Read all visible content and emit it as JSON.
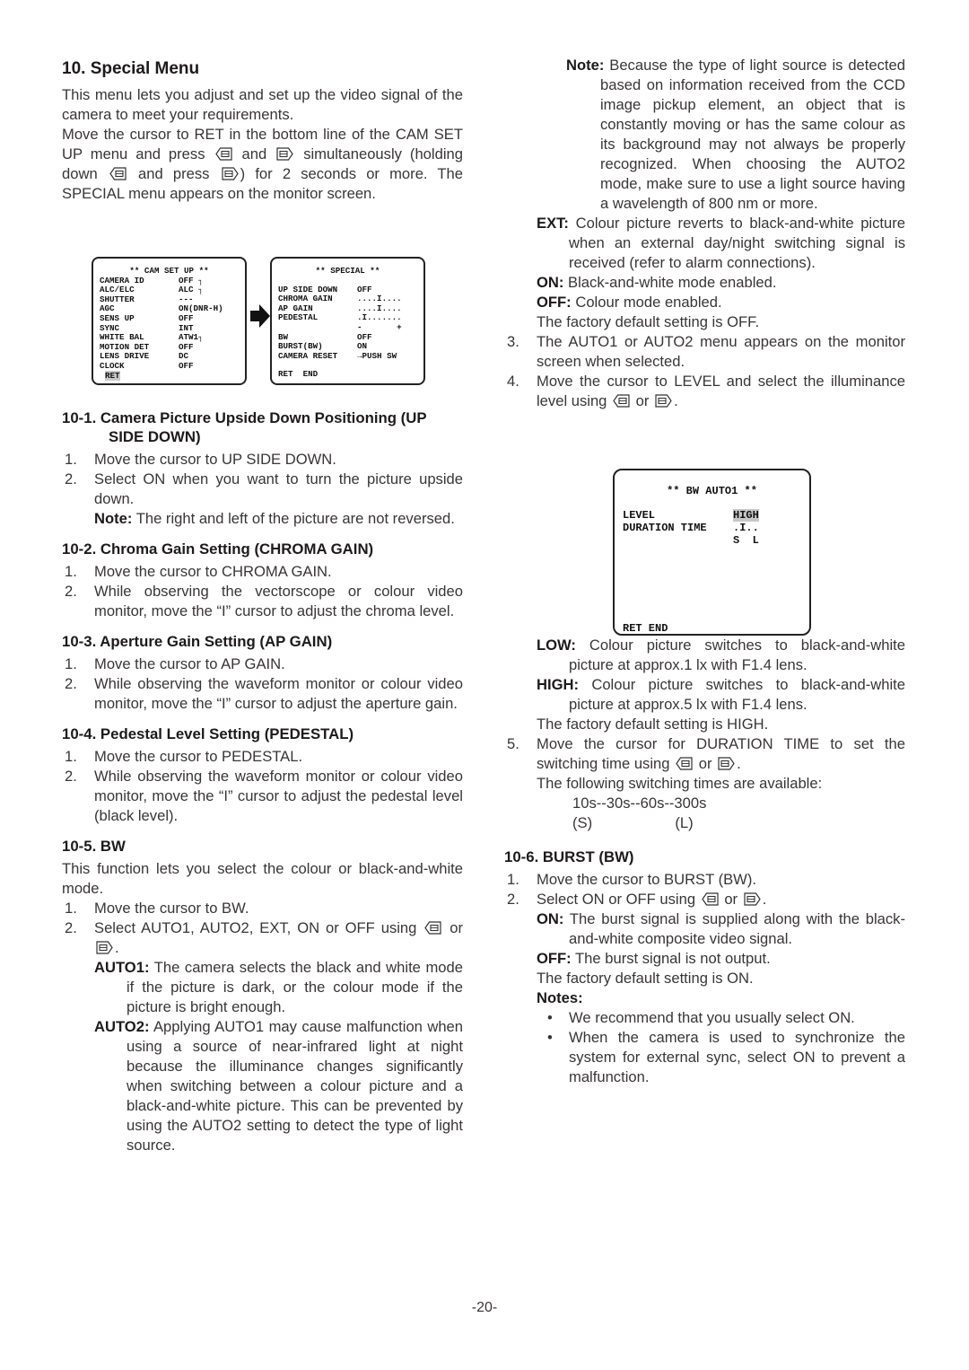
{
  "section": {
    "title": "10. Special Menu",
    "intro": "This menu lets you adjust and set up the video signal of the camera to meet your requirements.",
    "instr_1": "Move the cursor to RET in the bottom line of the CAM SET UP menu and press",
    "instr_2": "and",
    "instr_3": "simultaneously (holding down",
    "instr_4": "and press",
    "instr_5": ") for 2 seconds or more. The SPECIAL menu appears on the monitor screen."
  },
  "icons": {
    "left_button": "left-button-icon",
    "right_button": "right-button-icon",
    "arrow": "arrow-right-icon"
  },
  "cam_setup_menu": {
    "title": "** CAM SET UP **",
    "rows": [
      {
        "label": "CAMERA ID",
        "value": "OFF ┐"
      },
      {
        "label": "ALC/ELC",
        "value": "ALC ┐"
      },
      {
        "label": "SHUTTER",
        "value": "---"
      },
      {
        "label": "AGC",
        "value": "ON(DNR-H)"
      },
      {
        "label": "SENS UP",
        "value": "OFF"
      },
      {
        "label": "SYNC",
        "value": "INT"
      },
      {
        "label": "WHITE BAL",
        "value": "ATW1┐"
      },
      {
        "label": "MOTION DET",
        "value": "OFF"
      },
      {
        "label": "LENS DRIVE",
        "value": "DC"
      },
      {
        "label": "CLOCK",
        "value": "OFF"
      }
    ],
    "footer": "RET"
  },
  "special_menu": {
    "title": "** SPECIAL **",
    "rows": [
      {
        "label": "UP SIDE DOWN",
        "value": "OFF"
      },
      {
        "label": "CHROMA GAIN",
        "value": "....I...."
      },
      {
        "label": "AP GAIN",
        "value": "....I...."
      },
      {
        "label": "PEDESTAL",
        "value": ".I......."
      },
      {
        "label": "",
        "value": "-       +"
      },
      {
        "label": "BW",
        "value": "OFF"
      },
      {
        "label": "BURST(BW)",
        "value": "ON"
      },
      {
        "label": "CAMERA RESET",
        "value": "→PUSH SW"
      }
    ],
    "footer": "RET  END"
  },
  "s10_1": {
    "title": "10-1. Camera Picture Upside Down Positioning (UP SIDE DOWN)",
    "steps": [
      "Move the cursor to UP SIDE DOWN.",
      "Select ON when you want to turn the picture upside down."
    ],
    "note_label": "Note:",
    "note_text": "The right and left of the picture are not reversed."
  },
  "s10_2": {
    "title": "10-2. Chroma Gain Setting (CHROMA GAIN)",
    "steps": [
      "Move the cursor to CHROMA GAIN.",
      "While observing the vectorscope or colour video monitor, move the “I” cursor to adjust the chroma level."
    ]
  },
  "s10_3": {
    "title": "10-3. Aperture Gain Setting (AP GAIN)",
    "steps": [
      "Move the cursor to AP GAIN.",
      "While observing the waveform monitor or colour video monitor, move the “I” cursor to adjust the aperture gain."
    ]
  },
  "s10_4": {
    "title": "10-4. Pedestal Level Setting (PEDESTAL)",
    "steps": [
      "Move the cursor to PEDESTAL.",
      "While observing the waveform monitor or colour video monitor, move the “I” cursor to adjust the pedestal level (black level)."
    ]
  },
  "s10_5": {
    "title": "10-5. BW",
    "intro": "This function lets you select the colour or black-and-white mode.",
    "step1": "Move the cursor to BW.",
    "step2_a": "Select AUTO1, AUTO2, EXT, ON or OFF using",
    "step2_b": "or",
    "auto1_label": "AUTO1:",
    "auto1_text": "The camera selects the black and white mode if the picture is dark, or the colour mode if the picture is bright enough.",
    "auto2_label": "AUTO2:",
    "auto2_text": "Applying AUTO1 may cause malfunction when using a source of near-infrared light at night because the illuminance changes significantly when switching between a colour picture and a black-and-white picture.  This can be prevented by using the AUTO2 setting to detect the type of light source.",
    "note_label": "Note:",
    "note_text": "Because the type of light source is detected based on information received from the CCD image pickup element, an object that is constantly moving or has the same colour as its background may not always be properly recognized. When choosing the AUTO2 mode, make sure to use a light source having a wavelength of 800 nm or more.",
    "ext_label": "EXT:",
    "ext_text": "Colour picture reverts to black-and-white picture when an external day/night switching signal is received (refer to alarm connections).",
    "on_label": "ON:",
    "on_text": "Black-and-white mode enabled.",
    "off_label": "OFF:",
    "off_text": "Colour mode enabled.",
    "default_text": "The factory default setting is OFF.",
    "step3": "The AUTO1 or AUTO2 menu appears on the monitor screen when selected.",
    "step4_a": "Move the cursor to LEVEL and select the illuminance level using",
    "step4_b": "or",
    "low_label": "LOW:",
    "low_text": "Colour picture switches to black-and-white picture at approx.1 lx with F1.4 lens.",
    "high_label": "HIGH:",
    "high_text": "Colour picture switches to black-and-white picture at approx.5 lx with F1.4 lens.",
    "level_default": "The factory default setting is HIGH.",
    "step5_a": "Move the cursor for DURATION TIME to set the switching time using",
    "step5_b": "or",
    "times_intro": "The following switching times are available:",
    "times": "10s--30s--60s--300s",
    "times_scale": "(S)                    (L)"
  },
  "bw_auto1_menu": {
    "title": "** BW AUTO1 **",
    "level_label": "LEVEL",
    "level_value": "HIGH",
    "duration_label": "DURATION TIME",
    "duration_value": ".I..",
    "duration_scale": "S  L",
    "footer": "RET END"
  },
  "s10_6": {
    "title": "10-6. BURST (BW)",
    "step1": "Move the cursor to BURST (BW).",
    "step2_a": "Select ON or OFF using",
    "step2_b": "or",
    "on_label": "ON:",
    "on_text": "The burst signal is supplied along with the black-and-white composite video signal.",
    "off_label": "OFF:",
    "off_text": "The burst signal is not output.",
    "default_text": "The factory default setting is ON.",
    "notes_label": "Notes:",
    "notes": [
      "We recommend that you usually select ON.",
      "When the camera is used to synchronize the system for external sync, select ON to prevent a malfunction."
    ]
  },
  "page_number": "-20-"
}
